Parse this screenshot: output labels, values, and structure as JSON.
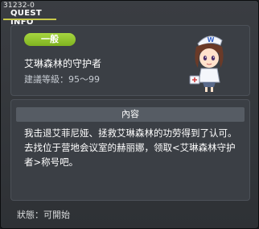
{
  "window": {
    "id_label": "31232-0",
    "title": "QUEST INFO"
  },
  "quest": {
    "category": "一般",
    "name": "艾琳森林的守护者",
    "level_label": "建議等級：95～99"
  },
  "content": {
    "header": "內容",
    "body": "我击退艾菲尼娅、拯救艾琳森林的功劳得到了认可。去找位于营地会议室的赫丽娜，领取<艾琳森林守护者>称号吧。"
  },
  "status": {
    "label": "狀態：可開始"
  },
  "colors": {
    "badge_green": "#8fc22c",
    "title_underline": "#c8c84a",
    "panel_bg": "#3b3f45",
    "header_bg": "#565c64"
  }
}
